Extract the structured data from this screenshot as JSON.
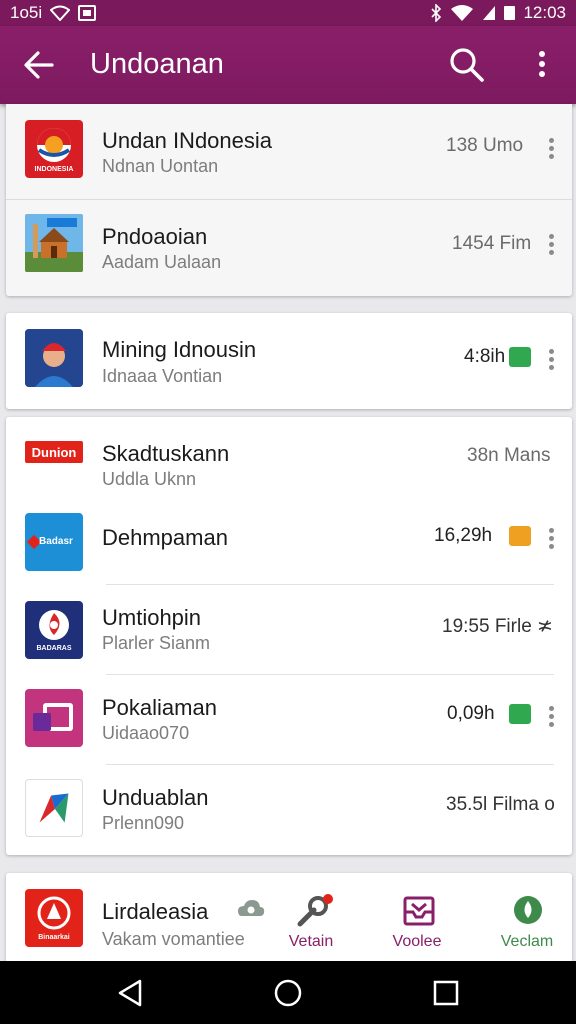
{
  "status_bar": {
    "left_text": "1o5i",
    "time": "12:03"
  },
  "app_bar": {
    "title": "Undoanan"
  },
  "list_top": [
    {
      "name": "Undan INdonesia",
      "subtitle": "Ndnan Uontan",
      "meta": "138 Umo",
      "icon": "indonesia-logo-icon",
      "icon_text": "INDONESIA"
    },
    {
      "name": "Pndoaoian",
      "subtitle": "Aadam Ualaan",
      "meta": "1454 Fim",
      "icon": "mosque-building-icon"
    }
  ],
  "list_middle": [
    {
      "name": "Mining Idnousin",
      "subtitle": "Idnaaa Vontian",
      "meta": "4:8ih",
      "icon": "person-avatar-icon",
      "tag_color": "#2fa84f"
    }
  ],
  "list_main": [
    {
      "name": "Skadtuskann",
      "subtitle": "Uddla Uknn",
      "meta": "38n Mans",
      "icon": "red-banner-logo-icon",
      "icon_text": "Dunion"
    },
    {
      "name": "Dehmpaman",
      "subtitle": "",
      "meta": "16,29h",
      "icon": "blue-brand-logo-icon",
      "icon_text": "Badasr",
      "tag_color": "#f0a020"
    },
    {
      "name": "Umtiohpin",
      "subtitle": "Plarler Sianm",
      "meta": "19:55 Firle ≭",
      "icon": "circle-emblem-icon",
      "icon_text": "BADARAS"
    },
    {
      "name": "Pokaliaman",
      "subtitle": "Uidaao070",
      "meta": "0,09h",
      "icon": "purple-card-logo-icon",
      "tag_color": "#2fa84f"
    },
    {
      "name": "Unduablan",
      "subtitle": "Prlenn090",
      "meta": "35.5l Filma o",
      "icon": "geometric-logo-icon"
    }
  ],
  "list_bottom": [
    {
      "name": "Lirdaleasia",
      "subtitle": "Vakam vomantiee",
      "icon": "red-seal-logo-icon",
      "icon_text": "Binaarkai"
    }
  ],
  "bottom_nav": [
    {
      "label": "",
      "icon": "cloud-eye-icon",
      "color": "#7a8a7f"
    },
    {
      "label": "Vetain",
      "icon": "wrench-badge-icon",
      "color": "#8a1f69"
    },
    {
      "label": "Voolee",
      "icon": "inbox-tray-icon",
      "color": "#8a1f69"
    },
    {
      "label": "Veclam",
      "icon": "leaf-drop-icon",
      "color": "#3e8a4a"
    }
  ],
  "colors": {
    "primary": "#8a1f69",
    "status_bar": "#7a1a5c",
    "green_tag": "#2fa84f",
    "orange_tag": "#f0a020"
  }
}
